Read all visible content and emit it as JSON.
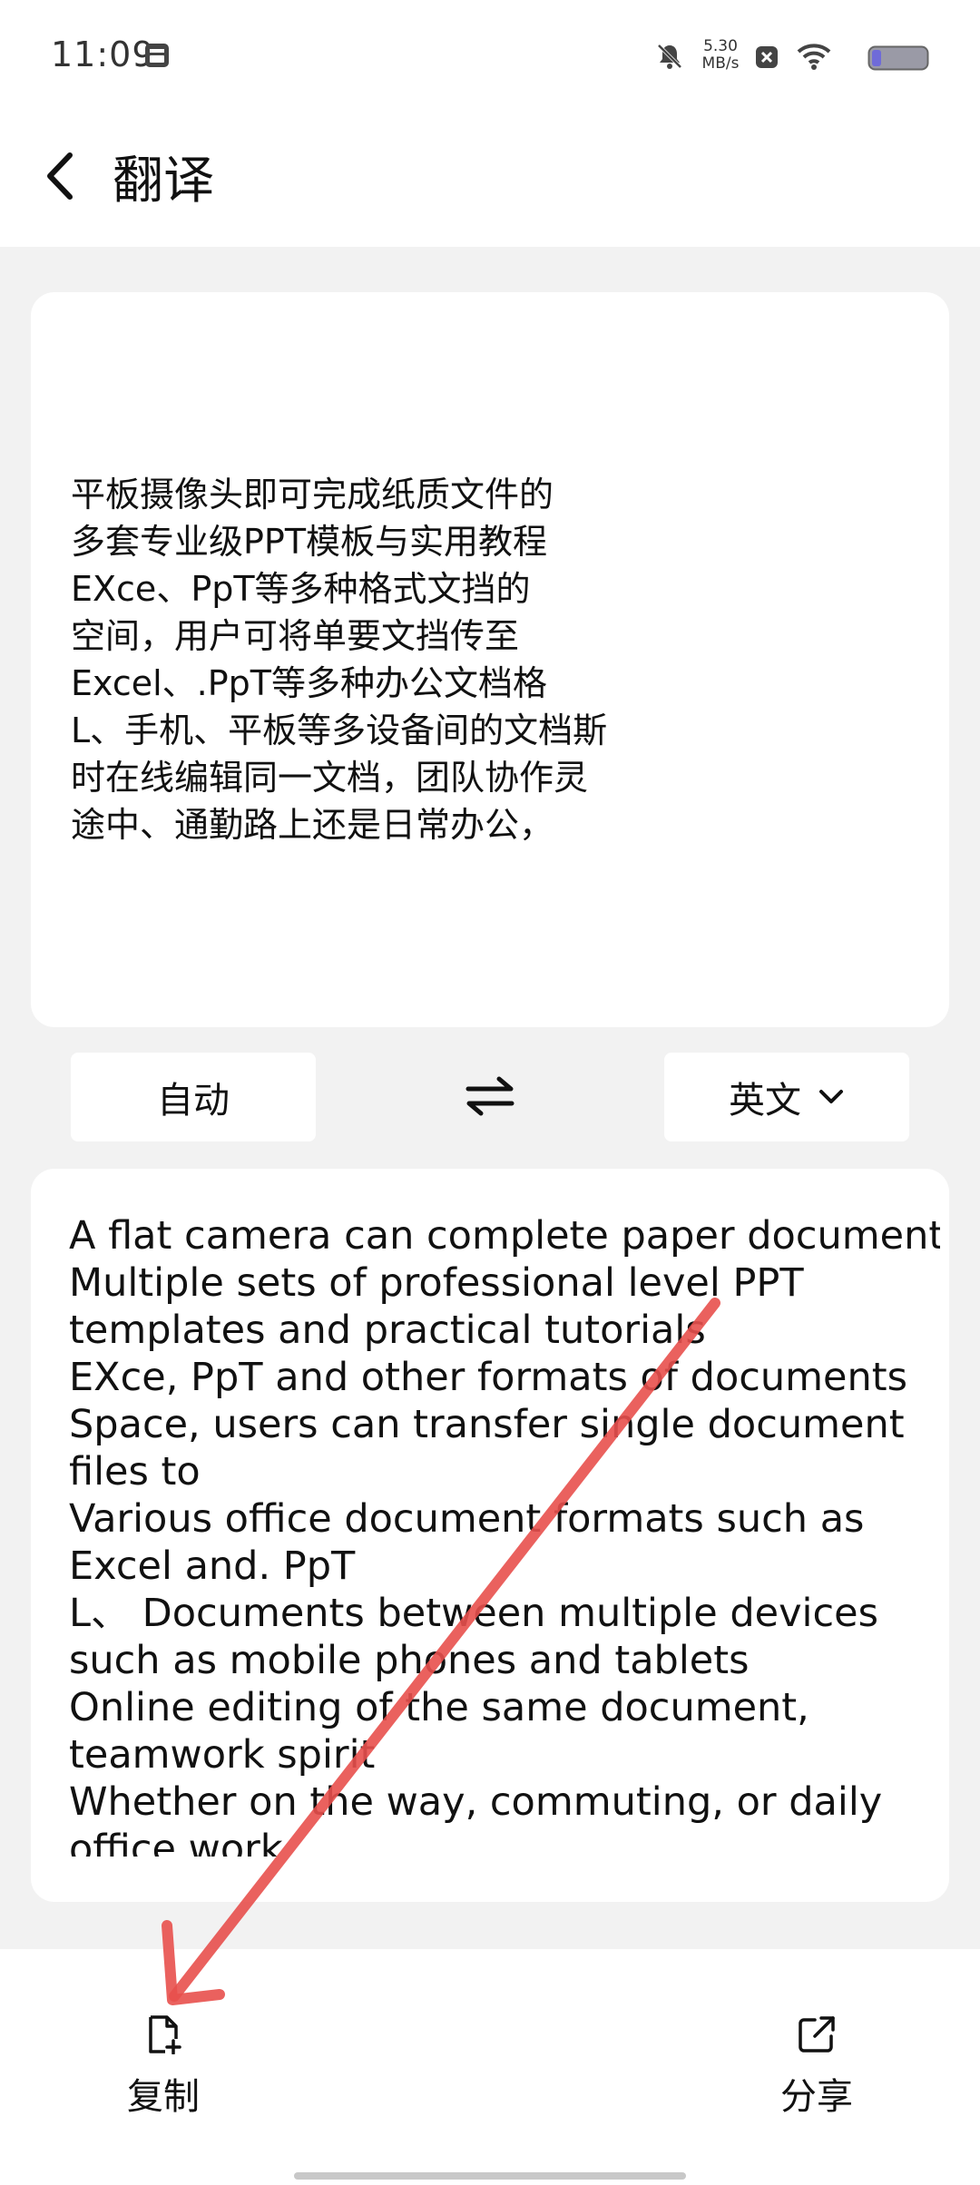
{
  "status": {
    "time": "11:09",
    "speed_value": "5.30",
    "speed_unit": "MB/s"
  },
  "header": {
    "title": "翻译"
  },
  "source": {
    "lines": [
      "平板摄像头即可完成纸质文件的",
      "多套专业级PPT模板与实用教程",
      "EXce、PpT等多种格式文挡的",
      "空间，用户可将单要文挡传至",
      "Excel、.PpT等多种办公文档格",
      "L、手机、平板等多设备间的文档斯",
      "时在线编辑同一文档，团队协作灵",
      "途中、通勤路上还是日常办公，"
    ]
  },
  "languages": {
    "source_label": "自动",
    "target_label": "英文"
  },
  "result": {
    "lines": [
      "A flat camera can complete paper documents",
      "Multiple sets of professional level PPT",
      "templates and practical tutorials",
      "EXce, PpT and other formats of documents",
      "Space, users can transfer single document",
      "files to",
      "Various office document formats such as",
      "Excel and. PpT",
      "L、 Documents between multiple devices",
      "such as mobile phones and tablets",
      "Online editing of the same document,",
      "teamwork spirit",
      "Whether on the way, commuting, or daily",
      "office work,"
    ]
  },
  "actions": {
    "copy_label": "复制",
    "share_label": "分享"
  },
  "annotation": {
    "arrow_color": "#e8504d"
  },
  "icons": [
    "notification-icon",
    "mute-icon",
    "close-box-icon",
    "wifi-icon",
    "battery-icon",
    "back-arrow-icon",
    "swap-icon",
    "chevron-down-icon",
    "copy-icon",
    "share-icon"
  ]
}
